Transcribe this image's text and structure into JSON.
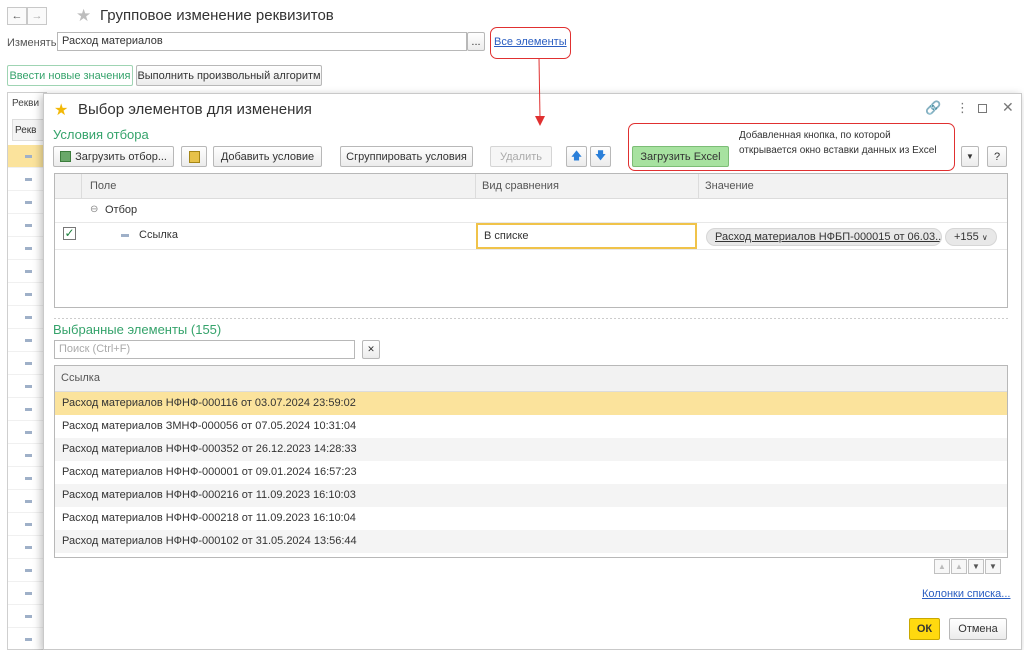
{
  "page": {
    "title": "Групповое изменение реквизитов",
    "change_label": "Изменять:",
    "change_value": "Расход материалов",
    "all_elements_link": "Все элементы",
    "tab_new_values": "Ввести новые значения",
    "tab_algorithm": "Выполнить произвольный алгоритм",
    "bg_header_1": "Рекви",
    "bg_header_2": "Рекв"
  },
  "dialog": {
    "title": "Выбор элементов для изменения",
    "filter_section_title": "Условия отбора",
    "toolbar": {
      "load_filter": "Загрузить отбор...",
      "add_condition": "Добавить условие",
      "group_conditions": "Сгруппировать условия",
      "delete": "Удалить",
      "load_excel": "Загрузить Excel",
      "help": "?"
    },
    "filter_table": {
      "col_field": "Поле",
      "col_comparison": "Вид сравнения",
      "col_value": "Значение",
      "group_label": "Отбор",
      "row_field": "Ссылка",
      "row_comparison": "В списке",
      "row_value": "Расход материалов НФБП-000015 от 06.03....",
      "row_more": "+155"
    },
    "selected_title": "Выбранные элементы (155)",
    "search_placeholder": "Поиск (Ctrl+F)",
    "list_header": "Ссылка",
    "rows": [
      "Расход материалов НФНФ-000116 от 03.07.2024 23:59:02",
      "Расход материалов ЗМНФ-000056 от 07.05.2024 10:31:04",
      "Расход материалов НФНФ-000352 от 26.12.2023 14:28:33",
      "Расход материалов НФНФ-000001 от 09.01.2024 16:57:23",
      "Расход материалов НФНФ-000216 от 11.09.2023 16:10:03",
      "Расход материалов НФНФ-000218 от 11.09.2023 16:10:04",
      "Расход материалов НФНФ-000102 от 31.05.2024 13:56:44"
    ],
    "columns_link": "Колонки списка...",
    "ok": "ОК",
    "cancel": "Отмена"
  },
  "annotation": {
    "text_line1": "Добавленная кнопка, по которой",
    "text_line2": "открывается окно вставки данных из Excel"
  },
  "colors": {
    "accent_green": "#35a36b",
    "highlight_row": "#fbe39c",
    "annotation_red": "#e03030",
    "ok_yellow": "#ffd90f",
    "excel_button_green": "#a7e2a0"
  }
}
